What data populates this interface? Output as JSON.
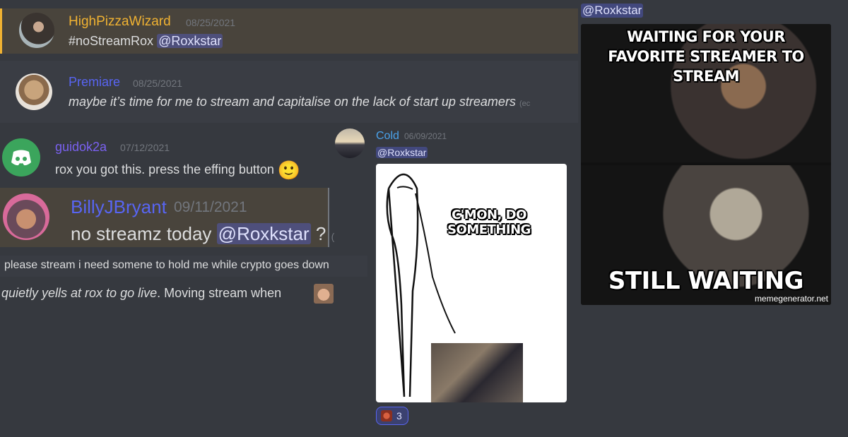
{
  "messages": {
    "m1": {
      "author": "HighPizzaWizard",
      "date": "08/25/2021",
      "text": "#noStreamRox",
      "mention": "@Roxkstar",
      "author_color": "#f0b232"
    },
    "m2": {
      "author": "Premiare",
      "date": "08/25/2021",
      "text": "maybe it’s time for me to stream and capitalise on the lack of start up streamers",
      "edited_hint": "(ec",
      "author_color": "#5865f2"
    },
    "m3": {
      "author": "guidok2a",
      "date": "07/12/2021",
      "text": "rox you got this. press the effing button",
      "emoji": "🙂",
      "author_color": "#7a61f0"
    },
    "m4": {
      "author": "BillyJBryant",
      "date": "09/11/2021",
      "text": "no streamz today",
      "mention": "@Roxkstar",
      "suffix": "?",
      "edited_hint": "(",
      "author_color": "#5865f2"
    },
    "m5": {
      "text": "please stream i need somene to hold me while crypto goes down"
    },
    "m6": {
      "italic": "quietly yells at rox to go live",
      "text": ". Moving stream when"
    },
    "m7": {
      "author": "Cold",
      "date": "06/09/2021",
      "mention": "@Roxkstar",
      "author_color": "#4aa3ec",
      "meme_text": "C'MON, DO SOMETHING",
      "reaction_count": "3"
    },
    "m8": {
      "mention": "@Roxkstar",
      "meme_top": "WAITING FOR YOUR FAVORITE STREAMER TO STREAM",
      "meme_bottom": "STILL WAITING",
      "watermark": "memegenerator.net"
    }
  },
  "colors": {
    "background": "#36393f",
    "highlight": "#49443c",
    "mention_bg": "#4a4f8f",
    "date": "#72767d"
  },
  "icons": [
    "discord-logo-icon",
    "smiley-emoji-icon",
    "reaction-emoji-icon"
  ]
}
